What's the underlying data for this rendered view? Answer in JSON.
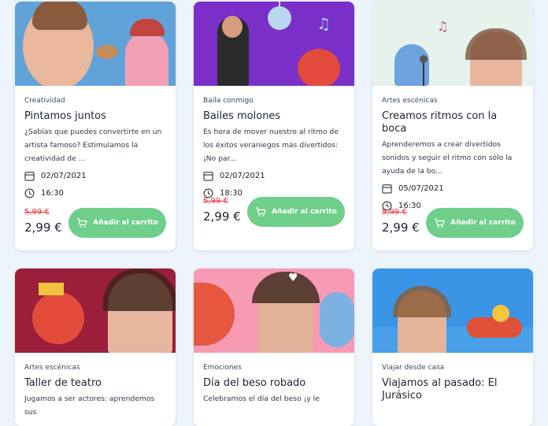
{
  "cards": [
    {
      "category": "Creatividad",
      "title": "Pintamos juntos",
      "description": "¿Sabías que puedes convertirte en un artista famoso? Estimulamos la creatividad de ...",
      "date": "02/07/2021",
      "time": "16:30",
      "old_price": "5,99 €",
      "price": "2,99 €",
      "cta": "Añadir al carrito"
    },
    {
      "category": "Baila conmigo",
      "title": "Bailes molones",
      "description": "Es hora de mover nuestro al ritmo de los éxitos veraniegos más divertidos: ¡No par...",
      "date": "02/07/2021",
      "time": "18:30",
      "old_price": "5,99 €",
      "price": "2,99 €",
      "cta": "Añadir al carrito"
    },
    {
      "category": "Artes escénicas",
      "title": "Creamos ritmos con la boca",
      "description": "Aprenderemos a crear divertidos sonidos y seguir el ritmo con sólo la ayuda de la bo...",
      "date": "05/07/2021",
      "time": "16:30",
      "old_price": "5,99 €",
      "price": "2,99 €",
      "cta": "Añadir al carrito"
    },
    {
      "category": "Artes escénicas",
      "title": "Taller de teatro",
      "description": "Jugamos a ser actores: aprendemos sus"
    },
    {
      "category": "Emociones",
      "title": "Día del beso robado",
      "description": "Celebramos el día del beso ¡y le"
    },
    {
      "category": "Viajar desde casa",
      "title": "Viajamos al pasado: El Jurásico",
      "description": ""
    }
  ],
  "icons": {
    "date": "calendar-icon",
    "time": "clock-icon",
    "cart": "cart-icon"
  },
  "colors": {
    "cta": "#6fcf8a",
    "old_price": "#e03434",
    "background": "#eef4fb"
  }
}
